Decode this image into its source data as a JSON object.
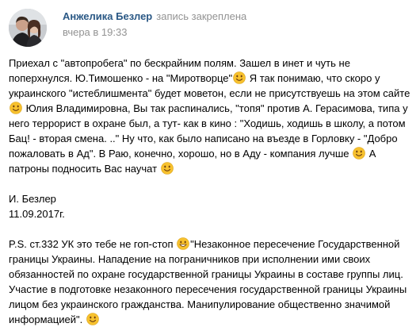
{
  "post": {
    "author": "Анжелика Безлер",
    "pinned_label": "запись закреплена",
    "date": "вчера в 19:33",
    "paragraph1": [
      {
        "t": "Приехал с \"автопробега\" по бескрайним полям. Зашел в инет и чуть не поперхнулся. Ю.Тимошенко - на \"Миротворце\""
      },
      {
        "e": "smile"
      },
      {
        "t": " Я так понимаю, что скоро у украинского \"истеблишмента\" будет моветон, если не присутствуешь на этом сайте "
      },
      {
        "e": "smile"
      },
      {
        "t": " Юлия Владимировна, Вы так распинались, \"топя\" против А. Герасимова, типа у него террорист в охране был, а тут- как в кино : \"Ходишь, ходишь в школу, а потом Бац! - вторая смена. ..\" Ну что, как было написано на въезде в Горловку - \"Добро пожаловать в Ад\". В Раю, конечно, хорошо, но в Аду - компания лучше "
      },
      {
        "e": "smile"
      },
      {
        "t": " А патроны подносить Вас научат "
      },
      {
        "e": "smile"
      }
    ],
    "signature_name": "И. Безлер",
    "signature_date": "11.09.2017г.",
    "paragraph2": [
      {
        "t": "P.S. ст.332 УК это тебе не гоп-стоп "
      },
      {
        "e": "grin"
      },
      {
        "t": "\"Незаконное пересечение Государственной границы Украины. Нападение на пограничников при исполнении ими своих обязанностей по охране государственной границы Украины в составе группы лиц. Участие в подготовке незаконного пересечения государственной границы Украины лицом без украинского гражданства. Манипулирование общественно значимой информацией\". "
      },
      {
        "e": "smile"
      }
    ]
  },
  "icons": {
    "avatar": "profile-photo",
    "smile": "smiling-face-emoji",
    "grin": "grinning-face-emoji"
  },
  "colors": {
    "author": "#2a5885",
    "meta": "#939393",
    "text": "#000000",
    "emoji": "#f7c12e"
  }
}
